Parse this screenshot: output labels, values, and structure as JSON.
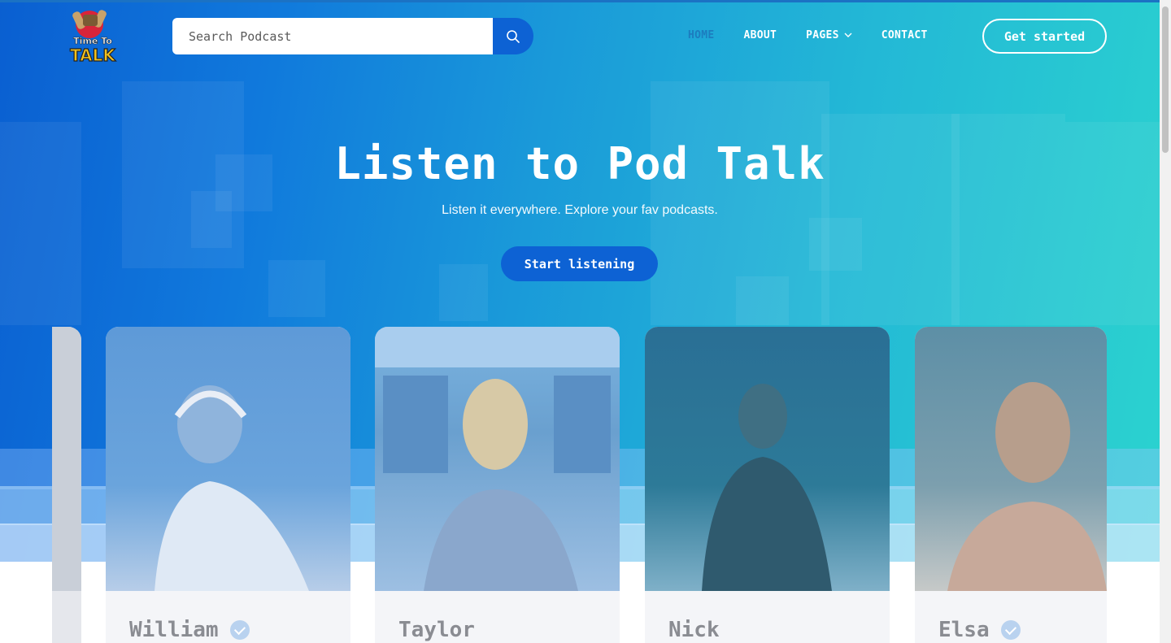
{
  "header": {
    "logo": {
      "line1": "Time To",
      "line2": "TALK"
    },
    "search": {
      "placeholder": "Search Podcast",
      "icon": "search-icon"
    },
    "nav": [
      {
        "label": "HOME",
        "active": true
      },
      {
        "label": "ABOUT",
        "active": false
      },
      {
        "label": "PAGES",
        "active": false,
        "icon": "chevron-down-icon"
      },
      {
        "label": "CONTACT",
        "active": false
      }
    ],
    "cta_label": "Get started"
  },
  "hero": {
    "title": "Listen to Pod Talk",
    "subtitle": "Listen it everywhere. Explore your fav podcasts.",
    "button_label": "Start listening"
  },
  "cards": [
    {
      "name": "William",
      "verified": true
    },
    {
      "name": "Taylor",
      "verified": false
    },
    {
      "name": "Nick",
      "verified": false
    },
    {
      "name": "Elsa",
      "verified": true
    }
  ],
  "colors": {
    "primary": "#0d62d4",
    "gradient_start": "#0a5fd1",
    "gradient_end": "#2bd3cf",
    "card_bg": "#f4f5f8"
  }
}
